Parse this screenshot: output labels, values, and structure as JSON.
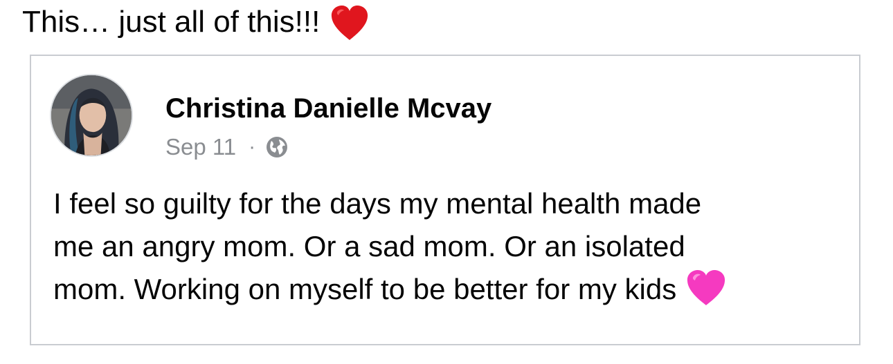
{
  "caption": {
    "text": "This… just all of this!!!",
    "emoji_icon": "red-heart-icon",
    "emoji_color": "#e0161e"
  },
  "shared_post": {
    "author_name": "Christina Danielle Mcvay",
    "date": "Sep 11",
    "separator": "·",
    "privacy_icon": "globe-icon",
    "body_lines": [
      "I feel so guilty for the days my mental health made",
      "me an angry mom. Or a sad mom. Or an isolated",
      "mom. Working on myself to be better for my kids"
    ],
    "body_emoji_icon": "pink-heart-icon",
    "body_emoji_color": "#f53ac0"
  },
  "colors": {
    "text": "#050505",
    "meta_text": "#8a8d91",
    "card_border": "#c9ccd1"
  }
}
